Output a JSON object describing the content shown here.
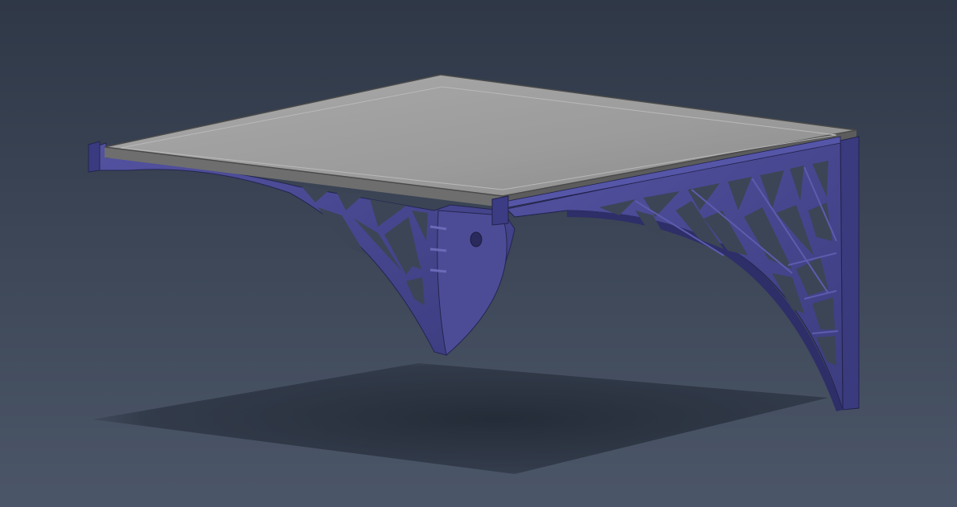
{
  "viewport": {
    "background_top": "#2f3847",
    "background_bottom": "#4b5668"
  },
  "model": {
    "bracket_color": "#4a4a8c",
    "bracket_light": "#5a5aa6",
    "bracket_dark": "#2e2e66",
    "glass_color": "#a3a3a3",
    "glass_edge": "#6a6a6a",
    "shadow_color": "#232a36"
  }
}
